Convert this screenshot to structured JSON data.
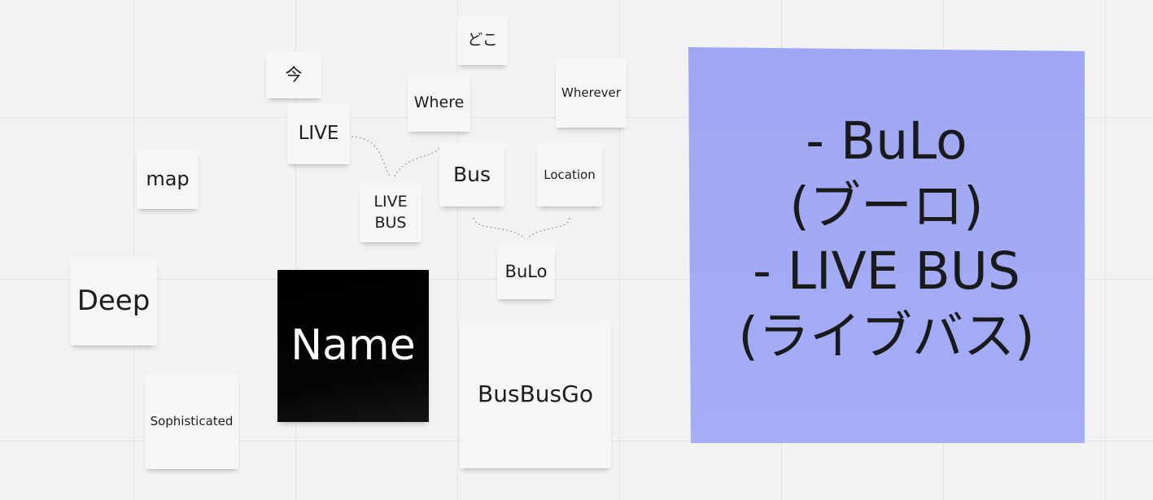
{
  "notes": {
    "doko": "どこ",
    "ima": "今",
    "where": "Where",
    "wherever": "Wherever",
    "live": "LIVE",
    "map": "map",
    "bus": "Bus",
    "location": "Location",
    "live_bus": "LIVE\nBUS",
    "bulo": "BuLo",
    "deep": "Deep",
    "name": "Name",
    "sophisticated": "Sophisticated",
    "busbusgo": "BusBusGo",
    "summary": "- BuLo\n(ブーロ)\n- LIVE BUS\n(ライブバス)"
  },
  "colors": {
    "canvas": "#f2f2f2",
    "grid": "#e3e3e3",
    "sticky_white": "#f6f6f6",
    "sticky_black": "#000000",
    "sticky_violet": "#a2a9f5"
  }
}
